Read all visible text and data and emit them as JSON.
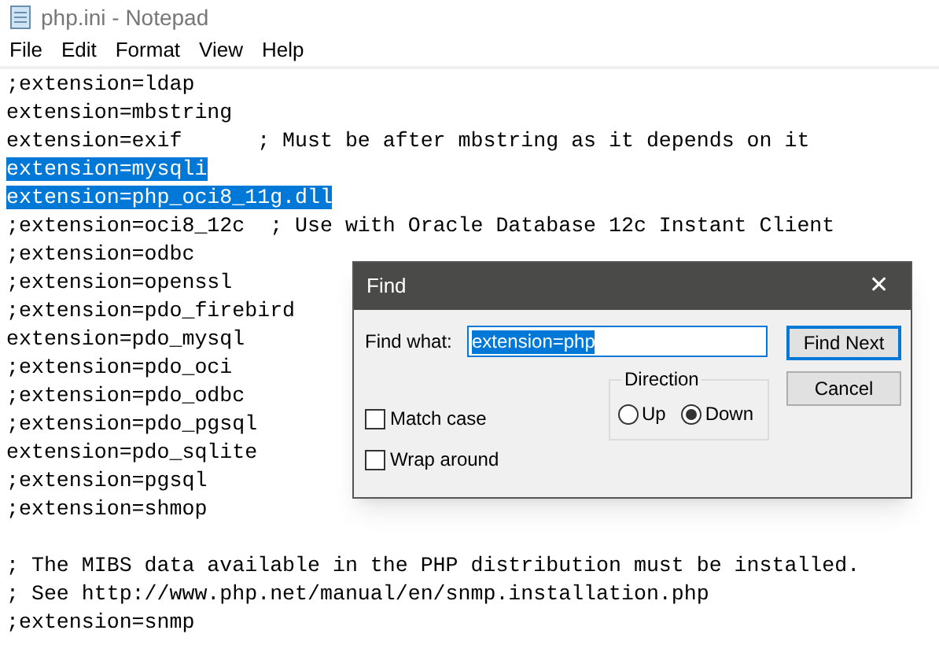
{
  "window": {
    "title": "php.ini - Notepad"
  },
  "menu": [
    "File",
    "Edit",
    "Format",
    "View",
    "Help"
  ],
  "lines": [
    {
      "kind": "code",
      "text": ";extension=ldap",
      "selected": false
    },
    {
      "kind": "code",
      "text": "extension=mbstring",
      "selected": false
    },
    {
      "kind": "code",
      "text": "extension=exif      ; Must be after mbstring as it depends on it",
      "selected": false
    },
    {
      "kind": "code",
      "text": "extension=mysqli",
      "selected": true
    },
    {
      "kind": "code",
      "text": "extension=php_oci8_11g.dll",
      "selected": true
    },
    {
      "kind": "code",
      "text": ";extension=oci8_12c  ; Use with Oracle Database 12c Instant Client",
      "selected": false
    },
    {
      "kind": "code",
      "text": ";extension=odbc",
      "selected": false
    },
    {
      "kind": "code",
      "text": ";extension=openssl",
      "selected": false
    },
    {
      "kind": "code",
      "text": ";extension=pdo_firebird",
      "selected": false
    },
    {
      "kind": "code",
      "text": "extension=pdo_mysql",
      "selected": false
    },
    {
      "kind": "code",
      "text": ";extension=pdo_oci",
      "selected": false
    },
    {
      "kind": "code",
      "text": ";extension=pdo_odbc",
      "selected": false
    },
    {
      "kind": "code",
      "text": ";extension=pdo_pgsql",
      "selected": false
    },
    {
      "kind": "code",
      "text": "extension=pdo_sqlite",
      "selected": false
    },
    {
      "kind": "code",
      "text": ";extension=pgsql",
      "selected": false
    },
    {
      "kind": "code",
      "text": ";extension=shmop",
      "selected": false
    },
    {
      "kind": "blank"
    },
    {
      "kind": "code",
      "text": "; The MIBS data available in the PHP distribution must be installed.",
      "selected": false
    },
    {
      "kind": "code",
      "text": "; See http://www.php.net/manual/en/snmp.installation.php",
      "selected": false
    },
    {
      "kind": "code",
      "text": ";extension=snmp",
      "selected": false
    }
  ],
  "find_dialog": {
    "title": "Find",
    "close": "✕",
    "find_label": "Find what:",
    "find_value": "extension=php",
    "buttons": [
      {
        "label": "Find Next",
        "default": true
      },
      {
        "label": "Cancel",
        "default": false
      }
    ],
    "direction": {
      "label": "Direction",
      "options": [
        {
          "label": "Up",
          "selected": false
        },
        {
          "label": "Down",
          "selected": true
        }
      ]
    },
    "checkboxes": [
      {
        "label": "Match case",
        "checked": false
      },
      {
        "label": "Wrap around",
        "checked": false
      }
    ]
  }
}
